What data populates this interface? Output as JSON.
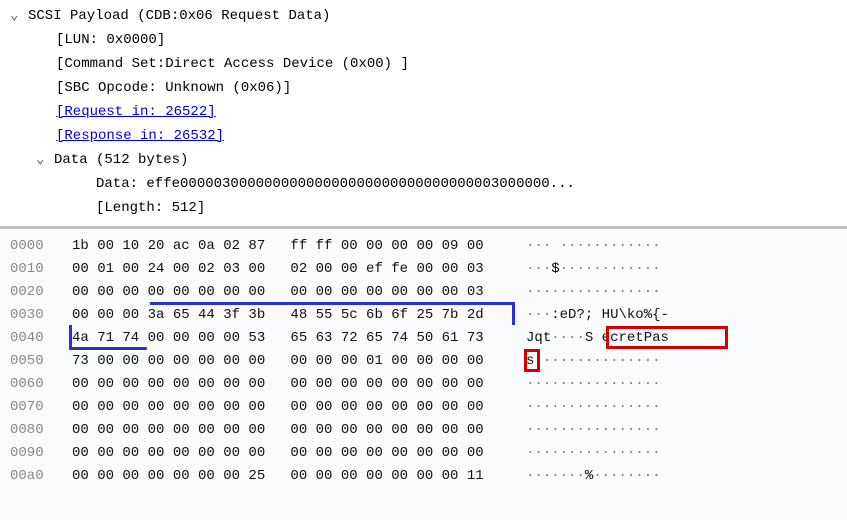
{
  "tree": {
    "root_label": "SCSI Payload (CDB:0x06 Request Data)",
    "lun": "[LUN: 0x0000]",
    "cmdset": "[Command Set:Direct Access Device (0x00) ]",
    "sbc": "[SBC Opcode: Unknown (0x06)]",
    "req_link": "[Request in: 26522]",
    "resp_link": "[Response in: 26532]",
    "data_header": "Data (512 bytes)",
    "data_hex": "Data: effe00000300000000000000000000000000000003000000...",
    "data_len": "[Length: 512]"
  },
  "hex": {
    "rows": [
      {
        "offset": "0000",
        "bytes1": "1b 00 10 20 ac 0a 02 87",
        "bytes2": "ff ff 00 00 00 00 09 00",
        "ascii": "··· ············"
      },
      {
        "offset": "0010",
        "bytes1": "00 01 00 24 00 02 03 00",
        "bytes2": "02 00 00 ef fe 00 00 03",
        "ascii": "···$············"
      },
      {
        "offset": "0020",
        "bytes1": "00 00 00 00 00 00 00 00",
        "bytes2": "00 00 00 00 00 00 00 03",
        "ascii": "················"
      },
      {
        "offset": "0030",
        "bytes1": "00 00 00 3a 65 44 3f 3b",
        "bytes2": "48 55 5c 6b 6f 25 7b 2d",
        "ascii": "···:eD?; HU\\ko%{-"
      },
      {
        "offset": "0040",
        "bytes1": "4a 71 74 00 00 00 00 53",
        "bytes2": "65 63 72 65 74 50 61 73",
        "ascii": "Jqt····S ecretPas"
      },
      {
        "offset": "0050",
        "bytes1": "73 00 00 00 00 00 00 00",
        "bytes2": "00 00 00 01 00 00 00 00",
        "ascii": "s···············"
      },
      {
        "offset": "0060",
        "bytes1": "00 00 00 00 00 00 00 00",
        "bytes2": "00 00 00 00 00 00 00 00",
        "ascii": "················"
      },
      {
        "offset": "0070",
        "bytes1": "00 00 00 00 00 00 00 00",
        "bytes2": "00 00 00 00 00 00 00 00",
        "ascii": "················"
      },
      {
        "offset": "0080",
        "bytes1": "00 00 00 00 00 00 00 00",
        "bytes2": "00 00 00 00 00 00 00 00",
        "ascii": "················"
      },
      {
        "offset": "0090",
        "bytes1": "00 00 00 00 00 00 00 00",
        "bytes2": "00 00 00 00 00 00 00 00",
        "ascii": "················"
      },
      {
        "offset": "00a0",
        "bytes1": "00 00 00 00 00 00 00 25",
        "bytes2": "00 00 00 00 00 00 00 11",
        "ascii": "·······%········"
      }
    ]
  },
  "highlights": {
    "blue_hex_segment": "3a 65 44 3f 3b 48 55 5c 6b 6f 25 7b 2d 4a 71 74",
    "red_ascii_1": "S ecretPas",
    "red_ascii_2": "s"
  }
}
